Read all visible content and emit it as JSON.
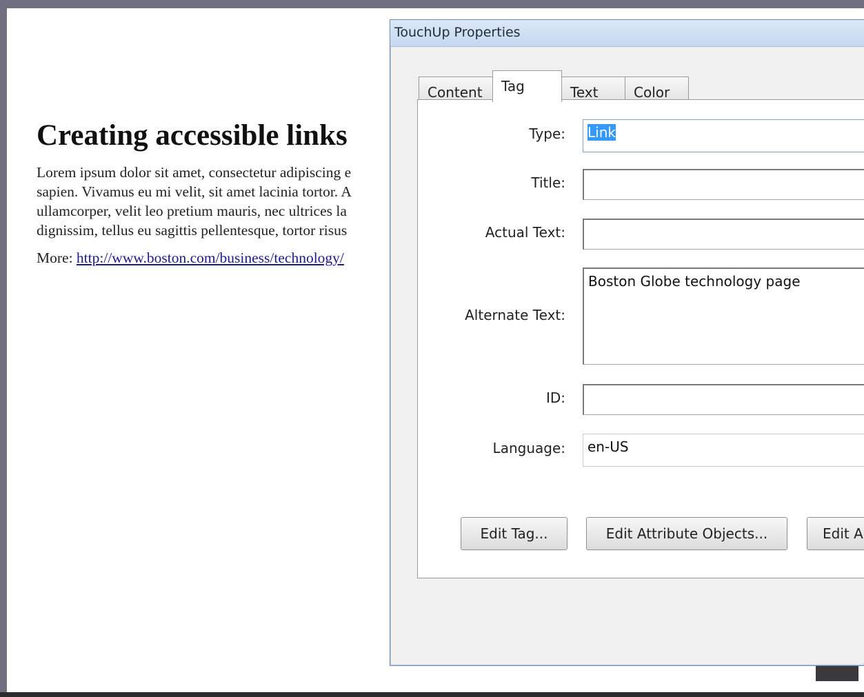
{
  "document": {
    "heading": "Creating accessible links",
    "paragraph_lines": [
      "Lorem ipsum dolor sit amet, consectetur adipiscing e",
      "sapien. Vivamus eu mi velit, sit amet lacinia tortor. A",
      "ullamcorper, velit leo pretium mauris, nec ultrices la",
      "dignissim, tellus eu sagittis pellentesque, tortor risus"
    ],
    "more_label": "More:",
    "more_link": "http://www.boston.com/business/technology/"
  },
  "dialog": {
    "title": "TouchUp Properties",
    "tabs": [
      {
        "label": "Content",
        "active": false
      },
      {
        "label": "Tag",
        "active": true
      },
      {
        "label": "Text",
        "active": false
      },
      {
        "label": "Color",
        "active": false
      }
    ],
    "fields": {
      "type": {
        "label": "Type:",
        "value": "Link"
      },
      "title": {
        "label": "Title:",
        "value": ""
      },
      "actual_text": {
        "label": "Actual Text:",
        "value": ""
      },
      "alternate_text": {
        "label": "Alternate Text:",
        "value": "Boston Globe technology page"
      },
      "id": {
        "label": "ID:",
        "value": ""
      },
      "language": {
        "label": "Language:",
        "value": "en-US"
      }
    },
    "buttons": {
      "edit_tag": "Edit Tag...",
      "edit_attribute_objects": "Edit Attribute Objects...",
      "edit_truncated": "Edit A"
    }
  },
  "colors": {
    "desktop": "#6f6f80",
    "dialog_titlebar": "#c4d8ef",
    "selection": "#3399ff",
    "link": "#1a1a8c"
  }
}
